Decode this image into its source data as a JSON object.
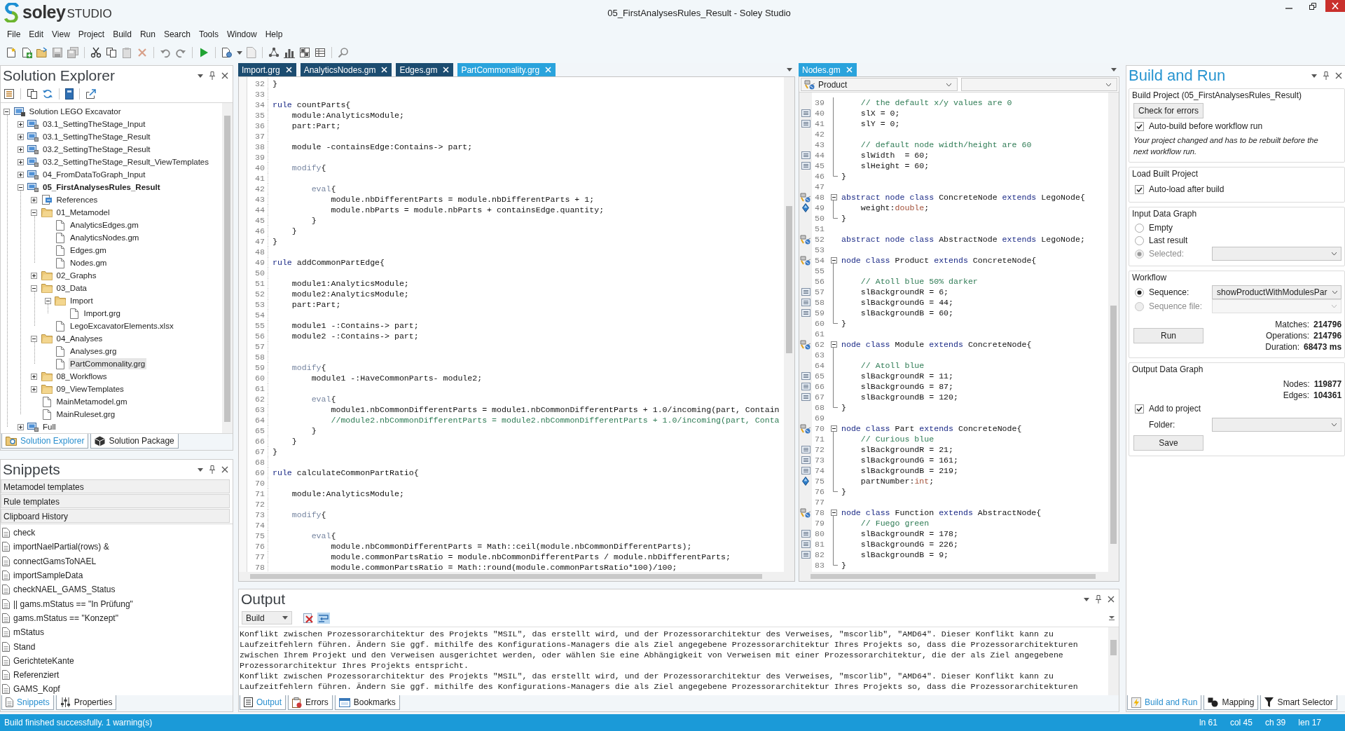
{
  "title_bar": {
    "logo_name": "soley",
    "logo_suffix": "STUDIO",
    "title": "05_FirstAnalysesRules_Result - Soley Studio"
  },
  "menu": [
    "File",
    "Edit",
    "View",
    "Project",
    "Build",
    "Run",
    "Search",
    "Tools",
    "Window",
    "Help"
  ],
  "solution_explorer": {
    "title": "Solution Explorer",
    "tree": [
      {
        "label": "Solution LEGO Excavator",
        "kind": "solution",
        "expanded": true,
        "selected": false,
        "children": [
          {
            "label": "03.1_SettingTheStage_Input",
            "kind": "project",
            "expanded": false,
            "selected": false,
            "active": false
          },
          {
            "label": "03.1_SettingTheStage_Result",
            "kind": "project",
            "expanded": false,
            "selected": false,
            "active": false
          },
          {
            "label": "03.2_SettingTheStage_Result",
            "kind": "project",
            "expanded": false,
            "selected": false,
            "active": false
          },
          {
            "label": "03.2_SettingTheStage_Result_ViewTemplates",
            "kind": "project",
            "expanded": false,
            "selected": false,
            "active": false
          },
          {
            "label": "04_FromDataToGraph_Input",
            "kind": "project",
            "expanded": false,
            "selected": false,
            "active": false
          },
          {
            "label": "05_FirstAnalysesRules_Result",
            "kind": "project",
            "expanded": true,
            "selected": false,
            "active": true,
            "children": [
              {
                "label": "References",
                "kind": "references",
                "expanded": false,
                "selected": false
              },
              {
                "label": "01_Metamodel",
                "kind": "folder",
                "expanded": true,
                "selected": false,
                "children": [
                  {
                    "label": "AnalyticsEdges.gm",
                    "kind": "file",
                    "selected": false
                  },
                  {
                    "label": "AnalyticsNodes.gm",
                    "kind": "file",
                    "selected": false
                  },
                  {
                    "label": "Edges.gm",
                    "kind": "file",
                    "selected": false
                  },
                  {
                    "label": "Nodes.gm",
                    "kind": "file",
                    "selected": false
                  }
                ]
              },
              {
                "label": "02_Graphs",
                "kind": "folder",
                "expanded": false,
                "selected": false
              },
              {
                "label": "03_Data",
                "kind": "folder",
                "expanded": true,
                "selected": false,
                "children": [
                  {
                    "label": "Import",
                    "kind": "folder",
                    "expanded": true,
                    "selected": false,
                    "children": [
                      {
                        "label": "Import.grg",
                        "kind": "file",
                        "selected": false
                      }
                    ]
                  },
                  {
                    "label": "LegoExcavatorElements.xlsx",
                    "kind": "file",
                    "selected": false
                  }
                ]
              },
              {
                "label": "04_Analyses",
                "kind": "folder",
                "expanded": true,
                "selected": false,
                "children": [
                  {
                    "label": "Analyses.grg",
                    "kind": "file",
                    "selected": false
                  },
                  {
                    "label": "PartCommonality.grg",
                    "kind": "file",
                    "selected": true
                  }
                ]
              },
              {
                "label": "08_Workflows",
                "kind": "folder",
                "expanded": false,
                "selected": false
              },
              {
                "label": "09_ViewTemplates",
                "kind": "folder",
                "expanded": false,
                "selected": false
              },
              {
                "label": "MainMetamodel.gm",
                "kind": "file",
                "selected": false
              },
              {
                "label": "MainRuleset.grg",
                "kind": "file",
                "selected": false
              }
            ]
          },
          {
            "label": "Full",
            "kind": "project",
            "expanded": false,
            "selected": false,
            "active": false
          }
        ]
      }
    ],
    "tabs": [
      {
        "label": "Solution Explorer",
        "selected": true
      },
      {
        "label": "Solution Package",
        "selected": false
      }
    ]
  },
  "snippets": {
    "title": "Snippets",
    "categories": [
      "Metamodel templates",
      "Rule templates",
      "Clipboard History"
    ],
    "items": [
      "check",
      "importNaelPartial(rows) &",
      "connectGamsToNAEL",
      "importSampleData",
      "checkNAEL_GAMS_Status",
      "|| gams.mStatus == \"In Prüfung\"",
      "gams.mStatus == \"Konzept\"",
      "mStatus",
      "Stand",
      "GerichteteKante",
      "Referenziert",
      "GAMS_Kopf"
    ],
    "tabs": [
      {
        "label": "Snippets",
        "selected": true
      },
      {
        "label": "Properties",
        "selected": false
      }
    ]
  },
  "main_editor": {
    "tabs": [
      {
        "label": "Import.grg",
        "selected": false
      },
      {
        "label": "AnalyticsNodes.gm",
        "selected": false
      },
      {
        "label": "Edges.gm",
        "selected": false
      },
      {
        "label": "PartCommonality.grg",
        "selected": true
      }
    ],
    "lines": [
      {
        "number": "32",
        "segments": [
          {
            "text": "}",
            "kind": "plain"
          }
        ]
      },
      {
        "number": "33"
      },
      {
        "number": "34",
        "segments": [
          {
            "text": "rule",
            "kind": "keyword"
          },
          {
            "text": " countParts{",
            "kind": "plain"
          }
        ]
      },
      {
        "number": "35",
        "segments": [
          {
            "text": "    module:AnalyticsModule;",
            "kind": "plain"
          }
        ]
      },
      {
        "number": "36",
        "segments": [
          {
            "text": "    part:Part;",
            "kind": "plain"
          }
        ]
      },
      {
        "number": "37"
      },
      {
        "number": "38",
        "segments": [
          {
            "text": "    module -containsEdge:Contains-> part;",
            "kind": "plain"
          }
        ]
      },
      {
        "number": "39"
      },
      {
        "number": "40",
        "segments": [
          {
            "text": "    modify",
            "kind": "block"
          },
          {
            "text": "{",
            "kind": "plain"
          }
        ]
      },
      {
        "number": "41"
      },
      {
        "number": "42",
        "segments": [
          {
            "text": "        eval",
            "kind": "block"
          },
          {
            "text": "{",
            "kind": "plain"
          }
        ]
      },
      {
        "number": "43",
        "segments": [
          {
            "text": "            module.nbDifferentParts = module.nbDifferentParts + 1;",
            "kind": "plain"
          }
        ]
      },
      {
        "number": "44",
        "segments": [
          {
            "text": "            module.nbParts = module.nbParts + containsEdge.quantity;",
            "kind": "plain"
          }
        ]
      },
      {
        "number": "45",
        "segments": [
          {
            "text": "        }",
            "kind": "plain"
          }
        ]
      },
      {
        "number": "46",
        "segments": [
          {
            "text": "    }",
            "kind": "plain"
          }
        ]
      },
      {
        "number": "47",
        "segments": [
          {
            "text": "}",
            "kind": "plain"
          }
        ]
      },
      {
        "number": "48"
      },
      {
        "number": "49",
        "segments": [
          {
            "text": "rule",
            "kind": "keyword"
          },
          {
            "text": " addCommonPartEdge{",
            "kind": "plain"
          }
        ]
      },
      {
        "number": "50"
      },
      {
        "number": "51",
        "segments": [
          {
            "text": "    module1:AnalyticsModule;",
            "kind": "plain"
          }
        ]
      },
      {
        "number": "52",
        "segments": [
          {
            "text": "    module2:AnalyticsModule;",
            "kind": "plain"
          }
        ]
      },
      {
        "number": "53",
        "segments": [
          {
            "text": "    part:Part;",
            "kind": "plain"
          }
        ]
      },
      {
        "number": "54"
      },
      {
        "number": "55",
        "segments": [
          {
            "text": "    module1 -:Contains-> part;",
            "kind": "plain"
          }
        ]
      },
      {
        "number": "56",
        "segments": [
          {
            "text": "    module2 -:Contains-> part;",
            "kind": "plain"
          }
        ]
      },
      {
        "number": "57"
      },
      {
        "number": "58"
      },
      {
        "number": "59",
        "segments": [
          {
            "text": "    modify",
            "kind": "block"
          },
          {
            "text": "{",
            "kind": "plain"
          }
        ]
      },
      {
        "number": "60",
        "segments": [
          {
            "text": "        module1 -:HaveCommonParts- module2;",
            "kind": "plain"
          }
        ]
      },
      {
        "number": "61"
      },
      {
        "number": "62",
        "segments": [
          {
            "text": "        eval",
            "kind": "block"
          },
          {
            "text": "{",
            "kind": "plain"
          }
        ]
      },
      {
        "number": "63",
        "segments": [
          {
            "text": "            module1.nbCommonDifferentParts = module1.nbCommonDifferentParts + 1.0/incoming(part, Contain",
            "kind": "plain"
          }
        ]
      },
      {
        "number": "64",
        "segments": [
          {
            "text": "            //module2.nbCommonDifferentParts = module2.nbCommonDifferentParts + 1.0/incoming(part, Conta",
            "kind": "comment"
          }
        ]
      },
      {
        "number": "65",
        "segments": [
          {
            "text": "        }",
            "kind": "plain"
          }
        ]
      },
      {
        "number": "66",
        "segments": [
          {
            "text": "    }",
            "kind": "plain"
          }
        ]
      },
      {
        "number": "67",
        "segments": [
          {
            "text": "}",
            "kind": "plain"
          }
        ]
      },
      {
        "number": "68"
      },
      {
        "number": "69",
        "segments": [
          {
            "text": "rule",
            "kind": "keyword"
          },
          {
            "text": " calculateCommonPartRatio{",
            "kind": "plain"
          }
        ]
      },
      {
        "number": "70"
      },
      {
        "number": "71",
        "segments": [
          {
            "text": "    module:AnalyticsModule;",
            "kind": "plain"
          }
        ]
      },
      {
        "number": "72"
      },
      {
        "number": "73",
        "segments": [
          {
            "text": "    modify",
            "kind": "block"
          },
          {
            "text": "{",
            "kind": "plain"
          }
        ]
      },
      {
        "number": "74"
      },
      {
        "number": "75",
        "segments": [
          {
            "text": "        eval",
            "kind": "block"
          },
          {
            "text": "{",
            "kind": "plain"
          }
        ]
      },
      {
        "number": "76",
        "segments": [
          {
            "text": "            module.nbCommonDifferentParts = Math::ceil(module.nbCommonDifferentParts);",
            "kind": "plain"
          }
        ]
      },
      {
        "number": "77",
        "segments": [
          {
            "text": "            module.commonPartsRatio = module.nbCommonDifferentParts / module.nbDifferentParts;",
            "kind": "plain"
          }
        ]
      },
      {
        "number": "78",
        "segments": [
          {
            "text": "            module.commonPartsRatio = Math::round(module.commonPartsRatio*100)/100;",
            "kind": "plain"
          }
        ]
      }
    ]
  },
  "nodes_editor": {
    "tabs": [
      {
        "label": "Nodes.gm",
        "selected": true
      }
    ],
    "type_dropdown": "Product",
    "lines": [
      {
        "number": "39",
        "fold_marker": {
          "kind": "inside"
        },
        "segments": [
          {
            "text": "    // the default x/y values are 0",
            "kind": "comment"
          }
        ]
      },
      {
        "number": "40",
        "fold_marker": {
          "kind": "inside"
        },
        "gutter_marker": {
          "kind": "property"
        },
        "segments": [
          {
            "text": "    slX = 0;",
            "kind": "plain"
          }
        ]
      },
      {
        "number": "41",
        "fold_marker": {
          "kind": "inside"
        },
        "gutter_marker": {
          "kind": "property"
        },
        "segments": [
          {
            "text": "    slY = 0;",
            "kind": "plain"
          }
        ]
      },
      {
        "number": "42",
        "fold_marker": {
          "kind": "inside"
        }
      },
      {
        "number": "43",
        "fold_marker": {
          "kind": "inside"
        },
        "segments": [
          {
            "text": "    // default node width/height are 60",
            "kind": "comment"
          }
        ]
      },
      {
        "number": "44",
        "fold_marker": {
          "kind": "inside"
        },
        "gutter_marker": {
          "kind": "property"
        },
        "segments": [
          {
            "text": "    slWidth  = 60;",
            "kind": "plain"
          }
        ]
      },
      {
        "number": "45",
        "fold_marker": {
          "kind": "inside"
        },
        "gutter_marker": {
          "kind": "property"
        },
        "segments": [
          {
            "text": "    slHeight = 60;",
            "kind": "plain"
          }
        ]
      },
      {
        "number": "46",
        "fold_marker": {
          "kind": "end"
        },
        "segments": [
          {
            "text": "}",
            "kind": "plain"
          }
        ]
      },
      {
        "number": "47"
      },
      {
        "number": "48",
        "fold_marker": {
          "kind": "start"
        },
        "gutter_marker": {
          "kind": "class"
        },
        "segments": [
          {
            "text": "abstract node class",
            "kind": "keyword"
          },
          {
            "text": " ConcreteNode ",
            "kind": "plain"
          },
          {
            "text": "extends",
            "kind": "keyword"
          },
          {
            "text": " LegoNode{",
            "kind": "plain"
          }
        ]
      },
      {
        "number": "49",
        "fold_marker": {
          "kind": "inside"
        },
        "gutter_marker": {
          "kind": "attribute"
        },
        "segments": [
          {
            "text": "    weight:",
            "kind": "plain"
          },
          {
            "text": "double",
            "kind": "type"
          },
          {
            "text": ";",
            "kind": "plain"
          }
        ]
      },
      {
        "number": "50",
        "fold_marker": {
          "kind": "end"
        },
        "segments": [
          {
            "text": "}",
            "kind": "plain"
          }
        ]
      },
      {
        "number": "51"
      },
      {
        "number": "52",
        "gutter_marker": {
          "kind": "class"
        },
        "segments": [
          {
            "text": "abstract node class",
            "kind": "keyword"
          },
          {
            "text": " AbstractNode ",
            "kind": "plain"
          },
          {
            "text": "extends",
            "kind": "keyword"
          },
          {
            "text": " LegoNode;",
            "kind": "plain"
          }
        ]
      },
      {
        "number": "53"
      },
      {
        "number": "54",
        "fold_marker": {
          "kind": "start"
        },
        "gutter_marker": {
          "kind": "class"
        },
        "segments": [
          {
            "text": "node class",
            "kind": "keyword"
          },
          {
            "text": " Product ",
            "kind": "plain"
          },
          {
            "text": "extends",
            "kind": "keyword"
          },
          {
            "text": " ConcreteNode{",
            "kind": "plain"
          }
        ]
      },
      {
        "number": "55",
        "fold_marker": {
          "kind": "inside"
        }
      },
      {
        "number": "56",
        "fold_marker": {
          "kind": "inside"
        },
        "segments": [
          {
            "text": "    // Atoll blue 50% darker",
            "kind": "comment"
          }
        ]
      },
      {
        "number": "57",
        "fold_marker": {
          "kind": "inside"
        },
        "gutter_marker": {
          "kind": "property"
        },
        "segments": [
          {
            "text": "    slBackgroundR = 6;",
            "kind": "plain"
          }
        ]
      },
      {
        "number": "58",
        "fold_marker": {
          "kind": "inside"
        },
        "gutter_marker": {
          "kind": "property"
        },
        "segments": [
          {
            "text": "    slBackgroundG = 44;",
            "kind": "plain"
          }
        ]
      },
      {
        "number": "59",
        "fold_marker": {
          "kind": "inside"
        },
        "gutter_marker": {
          "kind": "property"
        },
        "segments": [
          {
            "text": "    slBackgroundB = 60;",
            "kind": "plain"
          }
        ]
      },
      {
        "number": "60",
        "fold_marker": {
          "kind": "end"
        },
        "segments": [
          {
            "text": "}",
            "kind": "plain"
          }
        ]
      },
      {
        "number": "61"
      },
      {
        "number": "62",
        "fold_marker": {
          "kind": "start"
        },
        "gutter_marker": {
          "kind": "class"
        },
        "segments": [
          {
            "text": "node class",
            "kind": "keyword"
          },
          {
            "text": " Module ",
            "kind": "plain"
          },
          {
            "text": "extends",
            "kind": "keyword"
          },
          {
            "text": " ConcreteNode{",
            "kind": "plain"
          }
        ]
      },
      {
        "number": "63",
        "fold_marker": {
          "kind": "inside"
        }
      },
      {
        "number": "64",
        "fold_marker": {
          "kind": "inside"
        },
        "segments": [
          {
            "text": "    // Atoll blue",
            "kind": "comment"
          }
        ]
      },
      {
        "number": "65",
        "fold_marker": {
          "kind": "inside"
        },
        "gutter_marker": {
          "kind": "property"
        },
        "segments": [
          {
            "text": "    slBackgroundR = 11;",
            "kind": "plain"
          }
        ]
      },
      {
        "number": "66",
        "fold_marker": {
          "kind": "inside"
        },
        "gutter_marker": {
          "kind": "property"
        },
        "segments": [
          {
            "text": "    slBackgroundG = 87;",
            "kind": "plain"
          }
        ]
      },
      {
        "number": "67",
        "fold_marker": {
          "kind": "inside"
        },
        "gutter_marker": {
          "kind": "property"
        },
        "segments": [
          {
            "text": "    slBackgroundB = 120;",
            "kind": "plain"
          }
        ]
      },
      {
        "number": "68",
        "fold_marker": {
          "kind": "end"
        },
        "segments": [
          {
            "text": "}",
            "kind": "plain"
          }
        ]
      },
      {
        "number": "69"
      },
      {
        "number": "70",
        "fold_marker": {
          "kind": "start"
        },
        "gutter_marker": {
          "kind": "class"
        },
        "segments": [
          {
            "text": "node class",
            "kind": "keyword"
          },
          {
            "text": " Part ",
            "kind": "plain"
          },
          {
            "text": "extends",
            "kind": "keyword"
          },
          {
            "text": " ConcreteNode{",
            "kind": "plain"
          }
        ]
      },
      {
        "number": "71",
        "fold_marker": {
          "kind": "inside"
        },
        "segments": [
          {
            "text": "    // Curious blue",
            "kind": "comment"
          }
        ]
      },
      {
        "number": "72",
        "fold_marker": {
          "kind": "inside"
        },
        "gutter_marker": {
          "kind": "property"
        },
        "segments": [
          {
            "text": "    slBackgroundR = 21;",
            "kind": "plain"
          }
        ]
      },
      {
        "number": "73",
        "fold_marker": {
          "kind": "inside"
        },
        "gutter_marker": {
          "kind": "property"
        },
        "segments": [
          {
            "text": "    slBackgroundG = 161;",
            "kind": "plain"
          }
        ]
      },
      {
        "number": "74",
        "fold_marker": {
          "kind": "inside"
        },
        "gutter_marker": {
          "kind": "property"
        },
        "segments": [
          {
            "text": "    slBackgroundB = 219;",
            "kind": "plain"
          }
        ]
      },
      {
        "number": "75",
        "fold_marker": {
          "kind": "inside"
        },
        "gutter_marker": {
          "kind": "attribute"
        },
        "segments": [
          {
            "text": "    partNumber:",
            "kind": "plain"
          },
          {
            "text": "int",
            "kind": "type"
          },
          {
            "text": ";",
            "kind": "plain"
          }
        ]
      },
      {
        "number": "76",
        "fold_marker": {
          "kind": "end"
        },
        "segments": [
          {
            "text": "}",
            "kind": "plain"
          }
        ]
      },
      {
        "number": "77"
      },
      {
        "number": "78",
        "fold_marker": {
          "kind": "start"
        },
        "gutter_marker": {
          "kind": "class"
        },
        "segments": [
          {
            "text": "node class",
            "kind": "keyword"
          },
          {
            "text": " Function ",
            "kind": "plain"
          },
          {
            "text": "extends",
            "kind": "keyword"
          },
          {
            "text": " AbstractNode{",
            "kind": "plain"
          }
        ]
      },
      {
        "number": "79",
        "fold_marker": {
          "kind": "inside"
        },
        "segments": [
          {
            "text": "    // Fuego green",
            "kind": "comment"
          }
        ]
      },
      {
        "number": "80",
        "fold_marker": {
          "kind": "inside"
        },
        "gutter_marker": {
          "kind": "property"
        },
        "segments": [
          {
            "text": "    slBackgroundR = 178;",
            "kind": "plain"
          }
        ]
      },
      {
        "number": "81",
        "fold_marker": {
          "kind": "inside"
        },
        "gutter_marker": {
          "kind": "property"
        },
        "segments": [
          {
            "text": "    slBackgroundG = 226;",
            "kind": "plain"
          }
        ]
      },
      {
        "number": "82",
        "fold_marker": {
          "kind": "inside"
        },
        "gutter_marker": {
          "kind": "property"
        },
        "segments": [
          {
            "text": "    slBackgroundB = 9;",
            "kind": "plain"
          }
        ]
      },
      {
        "number": "83",
        "fold_marker": {
          "kind": "end"
        },
        "segments": [
          {
            "text": "}",
            "kind": "plain"
          }
        ]
      }
    ]
  },
  "output": {
    "title": "Output",
    "source": "Build",
    "messages": [
      "Konflikt zwischen Prozessorarchitektur des Projekts \"MSIL\", das erstellt wird, und der Prozessorarchitektur des Verweises, \"mscorlib\", \"AMD64\". Dieser Konflikt kann zu Laufzeitfehlern führen. Ändern Sie ggf. mithilfe des Konfigurations-Managers die als Ziel angegebene Prozessorarchitektur Ihres Projekts so, dass die Prozessorarchitekturen zwischen Ihrem Projekt und den Verweisen ausgerichtet werden, oder wählen Sie eine Abhängigkeit von Verweisen mit einer Prozessorarchitektur, die der als Ziel angegebene Prozessorarchitektur Ihres Projekts entspricht.",
      "Konflikt zwischen Prozessorarchitektur des Projekts \"MSIL\", das erstellt wird, und der Prozessorarchitektur des Verweises, \"mscorlib\", \"AMD64\". Dieser Konflikt kann zu Laufzeitfehlern führen. Ändern Sie ggf. mithilfe des Konfigurations-Managers die als Ziel angegebene Prozessorarchitektur Ihres Projekts so, dass die Prozessorarchitekturen"
    ],
    "tabs": [
      {
        "label": "Output",
        "selected": true
      },
      {
        "label": "Errors",
        "selected": false
      },
      {
        "label": "Bookmarks",
        "selected": false
      }
    ]
  },
  "build_and_run": {
    "title": "Build and Run",
    "build_project": {
      "title": "Build Project (05_FirstAnalysesRules_Result)",
      "check_button": "Check for errors",
      "auto_build": {
        "label": "Auto-build before workflow run",
        "checked": true
      },
      "notice": "Your project changed and has to be rebuilt before the next workflow run."
    },
    "load_built_project": {
      "title": "Load Built Project",
      "auto_load": {
        "label": "Auto-load after build",
        "checked": true
      }
    },
    "input_data_graph": {
      "title": "Input Data Graph",
      "options": [
        {
          "label": "Empty",
          "selected": false,
          "disabled": false
        },
        {
          "label": "Last result",
          "selected": false,
          "disabled": false
        },
        {
          "label": "Selected:",
          "selected": true,
          "disabled": true,
          "dropdown": {
            "disabled": false
          }
        }
      ]
    },
    "workflow": {
      "title": "Workflow",
      "options": [
        {
          "label": "Sequence:",
          "selected": true,
          "disabled": false,
          "dropdown": {
            "value": "showProductWithModulesPar",
            "disabled": false
          }
        },
        {
          "label": "Sequence file:",
          "selected": false,
          "disabled": true,
          "dropdown": {
            "disabled": true
          }
        }
      ],
      "run_button": "Run",
      "stats": [
        {
          "label": "Matches:",
          "value": "214796"
        },
        {
          "label": "Operations:",
          "value": "214796"
        },
        {
          "label": "Duration:",
          "value": "68473 ms"
        }
      ]
    },
    "output_data_graph": {
      "title": "Output Data Graph",
      "stats": [
        {
          "label": "Nodes:",
          "value": "119877"
        },
        {
          "label": "Edges:",
          "value": "104361"
        }
      ],
      "add_to_project": {
        "label": "Add to project",
        "checked": true
      },
      "folder_label": "Folder:",
      "folder_dropdown": {
        "disabled": false
      },
      "save_button": "Save"
    },
    "tabs": [
      {
        "label": "Build and Run",
        "selected": true
      },
      {
        "label": "Mapping",
        "selected": false
      },
      {
        "label": "Smart Selector",
        "selected": false
      }
    ]
  },
  "status_bar": {
    "message": "Build finished successfully. 1 warning(s)",
    "fields": [
      "ln 61",
      "col 45",
      "ch 39",
      "len 17"
    ]
  }
}
